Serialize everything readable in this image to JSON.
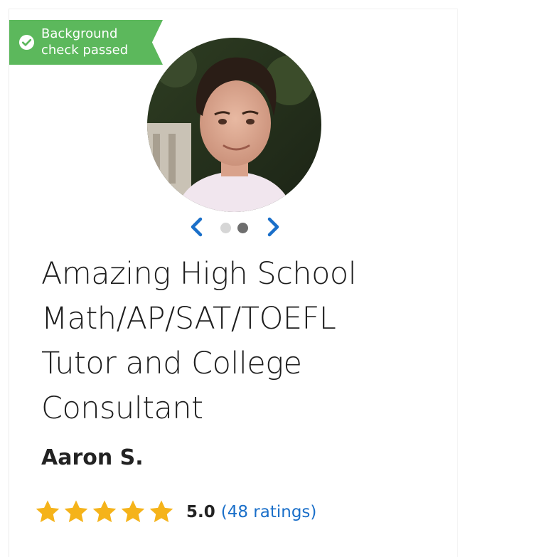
{
  "badge": {
    "icon": "check-circle-icon",
    "line1": "Background",
    "line2": "check passed",
    "color": "#5cb85c"
  },
  "profile": {
    "photo": "tutor-portrait",
    "title_lines": [
      "Amazing High School",
      "Math/AP/SAT/TOEFL",
      "Tutor and College",
      "Consultant"
    ],
    "name": "Aaron S."
  },
  "carousel": {
    "prev_icon": "chevron-left-icon",
    "next_icon": "chevron-right-icon",
    "slide_count": 2,
    "active_slide": 2,
    "arrow_color": "#1a6fc9"
  },
  "rating": {
    "stars": 5,
    "max_stars": 5,
    "star_color": "#f5b31a",
    "value": "5.0",
    "count_text": "(48 ratings)"
  }
}
